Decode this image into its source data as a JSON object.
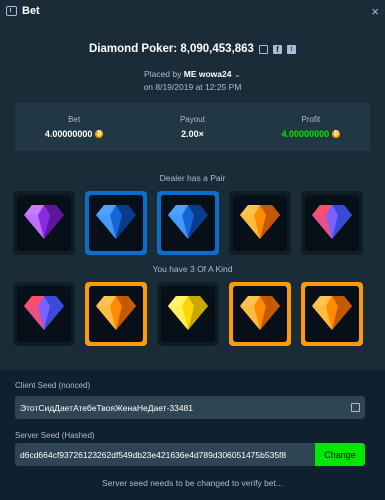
{
  "header": {
    "title": "Bet",
    "close_glyph": "×",
    "icon": "ticket-icon"
  },
  "title": {
    "text": "Diamond Poker: 8,090,453,863"
  },
  "placed": {
    "prefix": "Placed by",
    "user": "ME wowa24",
    "chevron": "⌄",
    "date": "on 8/19/2019 at 12:25 PM"
  },
  "stats": {
    "bet": {
      "label": "Bet",
      "value": "4.00000000"
    },
    "payout": {
      "label": "Payout",
      "value": "2.00×"
    },
    "profit": {
      "label": "Profit",
      "value": "4.00000000",
      "color": "#00e701"
    }
  },
  "dealer": {
    "label": "Dealer has a Pair",
    "cards": [
      {
        "gem": "purple",
        "highlight": "none"
      },
      {
        "gem": "blue",
        "highlight": "blue"
      },
      {
        "gem": "blue",
        "highlight": "blue"
      },
      {
        "gem": "orange",
        "highlight": "none"
      },
      {
        "gem": "red-blue",
        "highlight": "none"
      }
    ]
  },
  "player": {
    "label": "You have 3 Of A Kind",
    "cards": [
      {
        "gem": "red-blue",
        "highlight": "none"
      },
      {
        "gem": "orange",
        "highlight": "orange"
      },
      {
        "gem": "yellow",
        "highlight": "none"
      },
      {
        "gem": "orange",
        "highlight": "orange"
      },
      {
        "gem": "orange",
        "highlight": "orange"
      }
    ]
  },
  "client_seed": {
    "label": "Client Seed (nonced)",
    "value": "ЭтотСидДаетАтебеТвояЖенаНеДает-33481"
  },
  "server_seed": {
    "label": "Server Seed (Hashed)",
    "value": "d6cd664cf93726123262df549db23e421636e4d789d306051475b535f8",
    "button": "Change"
  },
  "footer": {
    "note": "Server seed needs to be changed to verify bet..."
  },
  "colors": {
    "bg": "#1a2c38",
    "panel": "#213743",
    "green": "#00e701",
    "blue": "#0d6ec9",
    "orange": "#ff9a0d"
  }
}
